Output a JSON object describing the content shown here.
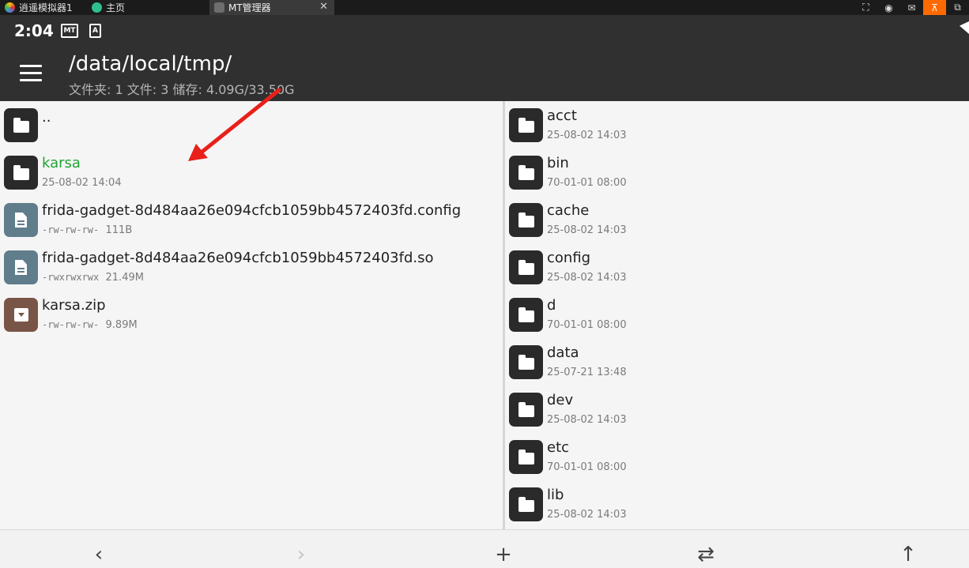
{
  "emulator": {
    "tabs": [
      {
        "label": "逍遥模拟器1",
        "icon": "emulator-logo-icon"
      },
      {
        "label": "主页",
        "icon": "home-icon"
      },
      {
        "label": "MT管理器",
        "icon": "mt-app-icon",
        "active": true
      }
    ],
    "window_controls": [
      "screenshot-icon",
      "account-icon",
      "mail-icon",
      "pin-icon",
      "window-restore-icon"
    ]
  },
  "statusbar": {
    "time": "2:04",
    "icons": [
      "mt-notification-icon",
      "a-notification-icon",
      "wifi-icon"
    ]
  },
  "appbar": {
    "path": "/data/local/tmp/",
    "subtitle": "文件夹: 1  文件: 3  储存: 4.09G/33.50G"
  },
  "left_pane": {
    "items": [
      {
        "name": "..",
        "meta": "",
        "type": "folder"
      },
      {
        "name": "karsa",
        "meta": "25-08-02 14:04",
        "type": "folder",
        "highlight": "#21a336"
      },
      {
        "name": "frida-gadget-8d484aa26e094cfcb1059bb4572403fd.config",
        "perm": "-rw-rw-rw-",
        "size": "111B",
        "type": "file"
      },
      {
        "name": "frida-gadget-8d484aa26e094cfcb1059bb4572403fd.so",
        "perm": "-rwxrwxrwx",
        "size": "21.49M",
        "type": "file"
      },
      {
        "name": "karsa.zip",
        "perm": "-rw-rw-rw-",
        "size": "9.89M",
        "type": "archive"
      }
    ]
  },
  "right_pane": {
    "items": [
      {
        "name": "acct",
        "meta": "25-08-02 14:03"
      },
      {
        "name": "bin",
        "meta": "70-01-01 08:00"
      },
      {
        "name": "cache",
        "meta": "25-08-02 14:03"
      },
      {
        "name": "config",
        "meta": "25-08-02 14:03"
      },
      {
        "name": "d",
        "meta": "70-01-01 08:00"
      },
      {
        "name": "data",
        "meta": "25-07-21 13:48"
      },
      {
        "name": "dev",
        "meta": "25-08-02 14:03"
      },
      {
        "name": "etc",
        "meta": "70-01-01 08:00"
      },
      {
        "name": "lib",
        "meta": "25-08-02 14:03"
      }
    ]
  },
  "bottombar": {
    "back": "‹",
    "forward": "›",
    "add": "+",
    "swap": "⇄",
    "up": "↑"
  },
  "colors": {
    "annotation_arrow": "#e8201a",
    "appbar": "#303030",
    "highlight": "#21a336"
  }
}
